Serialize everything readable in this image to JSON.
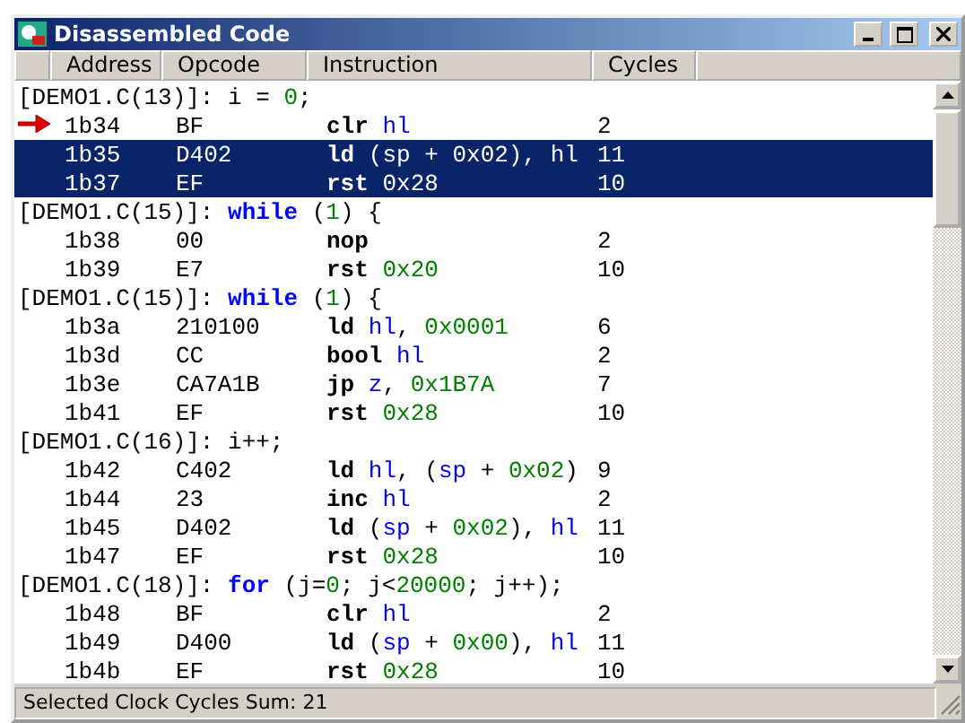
{
  "window": {
    "title": "Disassembled Code"
  },
  "columns": [
    "Address",
    "Opcode",
    "Instruction",
    "Cycles"
  ],
  "rows": [
    {
      "kind": "source",
      "code": [
        {
          "kind": "plain",
          "text": "[DEMO1.C(13)]: i = "
        },
        {
          "kind": "number",
          "text": "0"
        },
        {
          "kind": "plain",
          "text": ";"
        }
      ]
    },
    {
      "kind": "instruction",
      "current": true,
      "selected": false,
      "address": "1b34",
      "opcode": "BF",
      "code": [
        {
          "kind": "mnemonic",
          "text": "clr"
        },
        {
          "kind": "register",
          "text": "hl"
        }
      ],
      "cycles": "2"
    },
    {
      "kind": "instruction",
      "current": false,
      "selected": true,
      "address": "1b35",
      "opcode": "D402",
      "code": [
        {
          "kind": "mnemonic",
          "text": "ld"
        },
        {
          "kind": "plain",
          "text": "(sp + 0x02), hl"
        }
      ],
      "cycles": "11"
    },
    {
      "kind": "instruction",
      "current": false,
      "selected": true,
      "address": "1b37",
      "opcode": "EF",
      "code": [
        {
          "kind": "mnemonic",
          "text": "rst"
        },
        {
          "kind": "plain",
          "text": "0x28"
        }
      ],
      "cycles": "10"
    },
    {
      "kind": "source",
      "code": [
        {
          "kind": "plain",
          "text": "[DEMO1.C(15)]: "
        },
        {
          "kind": "keyword",
          "text": "while"
        },
        {
          "kind": "plain",
          "text": " ("
        },
        {
          "kind": "number",
          "text": "1"
        },
        {
          "kind": "plain",
          "text": ") {"
        }
      ]
    },
    {
      "kind": "instruction",
      "current": false,
      "selected": false,
      "address": "1b38",
      "opcode": "00",
      "code": [
        {
          "kind": "mnemonic",
          "text": "nop"
        }
      ],
      "cycles": "2"
    },
    {
      "kind": "instruction",
      "current": false,
      "selected": false,
      "address": "1b39",
      "opcode": "E7",
      "code": [
        {
          "kind": "mnemonic",
          "text": "rst"
        },
        {
          "kind": "number",
          "text": "0x20"
        }
      ],
      "cycles": "10"
    },
    {
      "kind": "source",
      "code": [
        {
          "kind": "plain",
          "text": "[DEMO1.C(15)]: "
        },
        {
          "kind": "keyword",
          "text": "while"
        },
        {
          "kind": "plain",
          "text": " ("
        },
        {
          "kind": "number",
          "text": "1"
        },
        {
          "kind": "plain",
          "text": ") {"
        }
      ]
    },
    {
      "kind": "instruction",
      "current": false,
      "selected": false,
      "address": "1b3a",
      "opcode": "210100",
      "code": [
        {
          "kind": "mnemonic",
          "text": "ld"
        },
        {
          "kind": "register",
          "text": "hl"
        },
        {
          "kind": "plain",
          "text": ", "
        },
        {
          "kind": "number",
          "text": "0x0001"
        }
      ],
      "cycles": "6"
    },
    {
      "kind": "instruction",
      "current": false,
      "selected": false,
      "address": "1b3d",
      "opcode": "CC",
      "code": [
        {
          "kind": "mnemonic",
          "text": "bool"
        },
        {
          "kind": "register",
          "text": "hl"
        }
      ],
      "cycles": "2"
    },
    {
      "kind": "instruction",
      "current": false,
      "selected": false,
      "address": "1b3e",
      "opcode": "CA7A1B",
      "code": [
        {
          "kind": "mnemonic",
          "text": "jp"
        },
        {
          "kind": "register",
          "text": "z"
        },
        {
          "kind": "plain",
          "text": ", "
        },
        {
          "kind": "number",
          "text": "0x1B7A"
        }
      ],
      "cycles": "7"
    },
    {
      "kind": "instruction",
      "current": false,
      "selected": false,
      "address": "1b41",
      "opcode": "EF",
      "code": [
        {
          "kind": "mnemonic",
          "text": "rst"
        },
        {
          "kind": "number",
          "text": "0x28"
        }
      ],
      "cycles": "10"
    },
    {
      "kind": "source",
      "code": [
        {
          "kind": "plain",
          "text": "[DEMO1.C(16)]: i++;"
        }
      ]
    },
    {
      "kind": "instruction",
      "current": false,
      "selected": false,
      "address": "1b42",
      "opcode": "C402",
      "code": [
        {
          "kind": "mnemonic",
          "text": "ld"
        },
        {
          "kind": "register",
          "text": "hl"
        },
        {
          "kind": "plain",
          "text": ", ("
        },
        {
          "kind": "register",
          "text": "sp"
        },
        {
          "kind": "plain",
          "text": " + "
        },
        {
          "kind": "number",
          "text": "0x02"
        },
        {
          "kind": "plain",
          "text": ")"
        }
      ],
      "cycles": "9"
    },
    {
      "kind": "instruction",
      "current": false,
      "selected": false,
      "address": "1b44",
      "opcode": "23",
      "code": [
        {
          "kind": "mnemonic",
          "text": "inc"
        },
        {
          "kind": "register",
          "text": "hl"
        }
      ],
      "cycles": "2"
    },
    {
      "kind": "instruction",
      "current": false,
      "selected": false,
      "address": "1b45",
      "opcode": "D402",
      "code": [
        {
          "kind": "mnemonic",
          "text": "ld"
        },
        {
          "kind": "plain",
          "text": "("
        },
        {
          "kind": "register",
          "text": "sp"
        },
        {
          "kind": "plain",
          "text": " + "
        },
        {
          "kind": "number",
          "text": "0x02"
        },
        {
          "kind": "plain",
          "text": "), "
        },
        {
          "kind": "register",
          "text": "hl"
        }
      ],
      "cycles": "11"
    },
    {
      "kind": "instruction",
      "current": false,
      "selected": false,
      "address": "1b47",
      "opcode": "EF",
      "code": [
        {
          "kind": "mnemonic",
          "text": "rst"
        },
        {
          "kind": "number",
          "text": "0x28"
        }
      ],
      "cycles": "10"
    },
    {
      "kind": "source",
      "code": [
        {
          "kind": "plain",
          "text": "[DEMO1.C(18)]: "
        },
        {
          "kind": "keyword",
          "text": "for"
        },
        {
          "kind": "plain",
          "text": " (j="
        },
        {
          "kind": "number",
          "text": "0"
        },
        {
          "kind": "plain",
          "text": "; j<"
        },
        {
          "kind": "number",
          "text": "20000"
        },
        {
          "kind": "plain",
          "text": "; j++);"
        }
      ]
    },
    {
      "kind": "instruction",
      "current": false,
      "selected": false,
      "address": "1b48",
      "opcode": "BF",
      "code": [
        {
          "kind": "mnemonic",
          "text": "clr"
        },
        {
          "kind": "register",
          "text": "hl"
        }
      ],
      "cycles": "2"
    },
    {
      "kind": "instruction",
      "current": false,
      "selected": false,
      "address": "1b49",
      "opcode": "D400",
      "code": [
        {
          "kind": "mnemonic",
          "text": "ld"
        },
        {
          "kind": "plain",
          "text": "("
        },
        {
          "kind": "register",
          "text": "sp"
        },
        {
          "kind": "plain",
          "text": " + "
        },
        {
          "kind": "number",
          "text": "0x00"
        },
        {
          "kind": "plain",
          "text": "), "
        },
        {
          "kind": "register",
          "text": "hl"
        }
      ],
      "cycles": "11"
    },
    {
      "kind": "instruction",
      "current": false,
      "selected": false,
      "address": "1b4b",
      "opcode": "EF",
      "code": [
        {
          "kind": "mnemonic",
          "text": "rst"
        },
        {
          "kind": "number",
          "text": "0x28"
        }
      ],
      "cycles": "10"
    }
  ],
  "status_bar": "Selected Clock Cycles Sum: 21"
}
